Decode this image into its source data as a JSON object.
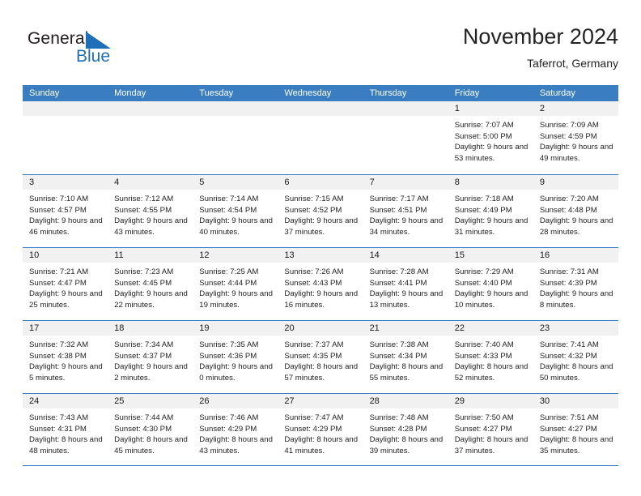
{
  "brand": {
    "name_part1": "General",
    "name_part2": "Blue",
    "accent_color": "#1f6fb8",
    "flag_icon": "triangle-flag-icon"
  },
  "header": {
    "title": "November 2024",
    "subtitle": "Taferrot, Germany"
  },
  "calendar": {
    "header_bg": "#3a7dc0",
    "day_head_bg": "#f1f1f1",
    "weekday_names": [
      "Sunday",
      "Monday",
      "Tuesday",
      "Wednesday",
      "Thursday",
      "Friday",
      "Saturday"
    ],
    "weeks": [
      [
        {
          "date": "",
          "sunrise": "",
          "sunset": "",
          "daylight": "",
          "empty": true
        },
        {
          "date": "",
          "sunrise": "",
          "sunset": "",
          "daylight": "",
          "empty": true
        },
        {
          "date": "",
          "sunrise": "",
          "sunset": "",
          "daylight": "",
          "empty": true
        },
        {
          "date": "",
          "sunrise": "",
          "sunset": "",
          "daylight": "",
          "empty": true
        },
        {
          "date": "",
          "sunrise": "",
          "sunset": "",
          "daylight": "",
          "empty": true
        },
        {
          "date": "1",
          "sunrise": "Sunrise: 7:07 AM",
          "sunset": "Sunset: 5:00 PM",
          "daylight": "Daylight: 9 hours and 53 minutes.",
          "empty": false
        },
        {
          "date": "2",
          "sunrise": "Sunrise: 7:09 AM",
          "sunset": "Sunset: 4:59 PM",
          "daylight": "Daylight: 9 hours and 49 minutes.",
          "empty": false
        }
      ],
      [
        {
          "date": "3",
          "sunrise": "Sunrise: 7:10 AM",
          "sunset": "Sunset: 4:57 PM",
          "daylight": "Daylight: 9 hours and 46 minutes.",
          "empty": false
        },
        {
          "date": "4",
          "sunrise": "Sunrise: 7:12 AM",
          "sunset": "Sunset: 4:55 PM",
          "daylight": "Daylight: 9 hours and 43 minutes.",
          "empty": false
        },
        {
          "date": "5",
          "sunrise": "Sunrise: 7:14 AM",
          "sunset": "Sunset: 4:54 PM",
          "daylight": "Daylight: 9 hours and 40 minutes.",
          "empty": false
        },
        {
          "date": "6",
          "sunrise": "Sunrise: 7:15 AM",
          "sunset": "Sunset: 4:52 PM",
          "daylight": "Daylight: 9 hours and 37 minutes.",
          "empty": false
        },
        {
          "date": "7",
          "sunrise": "Sunrise: 7:17 AM",
          "sunset": "Sunset: 4:51 PM",
          "daylight": "Daylight: 9 hours and 34 minutes.",
          "empty": false
        },
        {
          "date": "8",
          "sunrise": "Sunrise: 7:18 AM",
          "sunset": "Sunset: 4:49 PM",
          "daylight": "Daylight: 9 hours and 31 minutes.",
          "empty": false
        },
        {
          "date": "9",
          "sunrise": "Sunrise: 7:20 AM",
          "sunset": "Sunset: 4:48 PM",
          "daylight": "Daylight: 9 hours and 28 minutes.",
          "empty": false
        }
      ],
      [
        {
          "date": "10",
          "sunrise": "Sunrise: 7:21 AM",
          "sunset": "Sunset: 4:47 PM",
          "daylight": "Daylight: 9 hours and 25 minutes.",
          "empty": false
        },
        {
          "date": "11",
          "sunrise": "Sunrise: 7:23 AM",
          "sunset": "Sunset: 4:45 PM",
          "daylight": "Daylight: 9 hours and 22 minutes.",
          "empty": false
        },
        {
          "date": "12",
          "sunrise": "Sunrise: 7:25 AM",
          "sunset": "Sunset: 4:44 PM",
          "daylight": "Daylight: 9 hours and 19 minutes.",
          "empty": false
        },
        {
          "date": "13",
          "sunrise": "Sunrise: 7:26 AM",
          "sunset": "Sunset: 4:43 PM",
          "daylight": "Daylight: 9 hours and 16 minutes.",
          "empty": false
        },
        {
          "date": "14",
          "sunrise": "Sunrise: 7:28 AM",
          "sunset": "Sunset: 4:41 PM",
          "daylight": "Daylight: 9 hours and 13 minutes.",
          "empty": false
        },
        {
          "date": "15",
          "sunrise": "Sunrise: 7:29 AM",
          "sunset": "Sunset: 4:40 PM",
          "daylight": "Daylight: 9 hours and 10 minutes.",
          "empty": false
        },
        {
          "date": "16",
          "sunrise": "Sunrise: 7:31 AM",
          "sunset": "Sunset: 4:39 PM",
          "daylight": "Daylight: 9 hours and 8 minutes.",
          "empty": false
        }
      ],
      [
        {
          "date": "17",
          "sunrise": "Sunrise: 7:32 AM",
          "sunset": "Sunset: 4:38 PM",
          "daylight": "Daylight: 9 hours and 5 minutes.",
          "empty": false
        },
        {
          "date": "18",
          "sunrise": "Sunrise: 7:34 AM",
          "sunset": "Sunset: 4:37 PM",
          "daylight": "Daylight: 9 hours and 2 minutes.",
          "empty": false
        },
        {
          "date": "19",
          "sunrise": "Sunrise: 7:35 AM",
          "sunset": "Sunset: 4:36 PM",
          "daylight": "Daylight: 9 hours and 0 minutes.",
          "empty": false
        },
        {
          "date": "20",
          "sunrise": "Sunrise: 7:37 AM",
          "sunset": "Sunset: 4:35 PM",
          "daylight": "Daylight: 8 hours and 57 minutes.",
          "empty": false
        },
        {
          "date": "21",
          "sunrise": "Sunrise: 7:38 AM",
          "sunset": "Sunset: 4:34 PM",
          "daylight": "Daylight: 8 hours and 55 minutes.",
          "empty": false
        },
        {
          "date": "22",
          "sunrise": "Sunrise: 7:40 AM",
          "sunset": "Sunset: 4:33 PM",
          "daylight": "Daylight: 8 hours and 52 minutes.",
          "empty": false
        },
        {
          "date": "23",
          "sunrise": "Sunrise: 7:41 AM",
          "sunset": "Sunset: 4:32 PM",
          "daylight": "Daylight: 8 hours and 50 minutes.",
          "empty": false
        }
      ],
      [
        {
          "date": "24",
          "sunrise": "Sunrise: 7:43 AM",
          "sunset": "Sunset: 4:31 PM",
          "daylight": "Daylight: 8 hours and 48 minutes.",
          "empty": false
        },
        {
          "date": "25",
          "sunrise": "Sunrise: 7:44 AM",
          "sunset": "Sunset: 4:30 PM",
          "daylight": "Daylight: 8 hours and 45 minutes.",
          "empty": false
        },
        {
          "date": "26",
          "sunrise": "Sunrise: 7:46 AM",
          "sunset": "Sunset: 4:29 PM",
          "daylight": "Daylight: 8 hours and 43 minutes.",
          "empty": false
        },
        {
          "date": "27",
          "sunrise": "Sunrise: 7:47 AM",
          "sunset": "Sunset: 4:29 PM",
          "daylight": "Daylight: 8 hours and 41 minutes.",
          "empty": false
        },
        {
          "date": "28",
          "sunrise": "Sunrise: 7:48 AM",
          "sunset": "Sunset: 4:28 PM",
          "daylight": "Daylight: 8 hours and 39 minutes.",
          "empty": false
        },
        {
          "date": "29",
          "sunrise": "Sunrise: 7:50 AM",
          "sunset": "Sunset: 4:27 PM",
          "daylight": "Daylight: 8 hours and 37 minutes.",
          "empty": false
        },
        {
          "date": "30",
          "sunrise": "Sunrise: 7:51 AM",
          "sunset": "Sunset: 4:27 PM",
          "daylight": "Daylight: 8 hours and 35 minutes.",
          "empty": false
        }
      ]
    ]
  }
}
